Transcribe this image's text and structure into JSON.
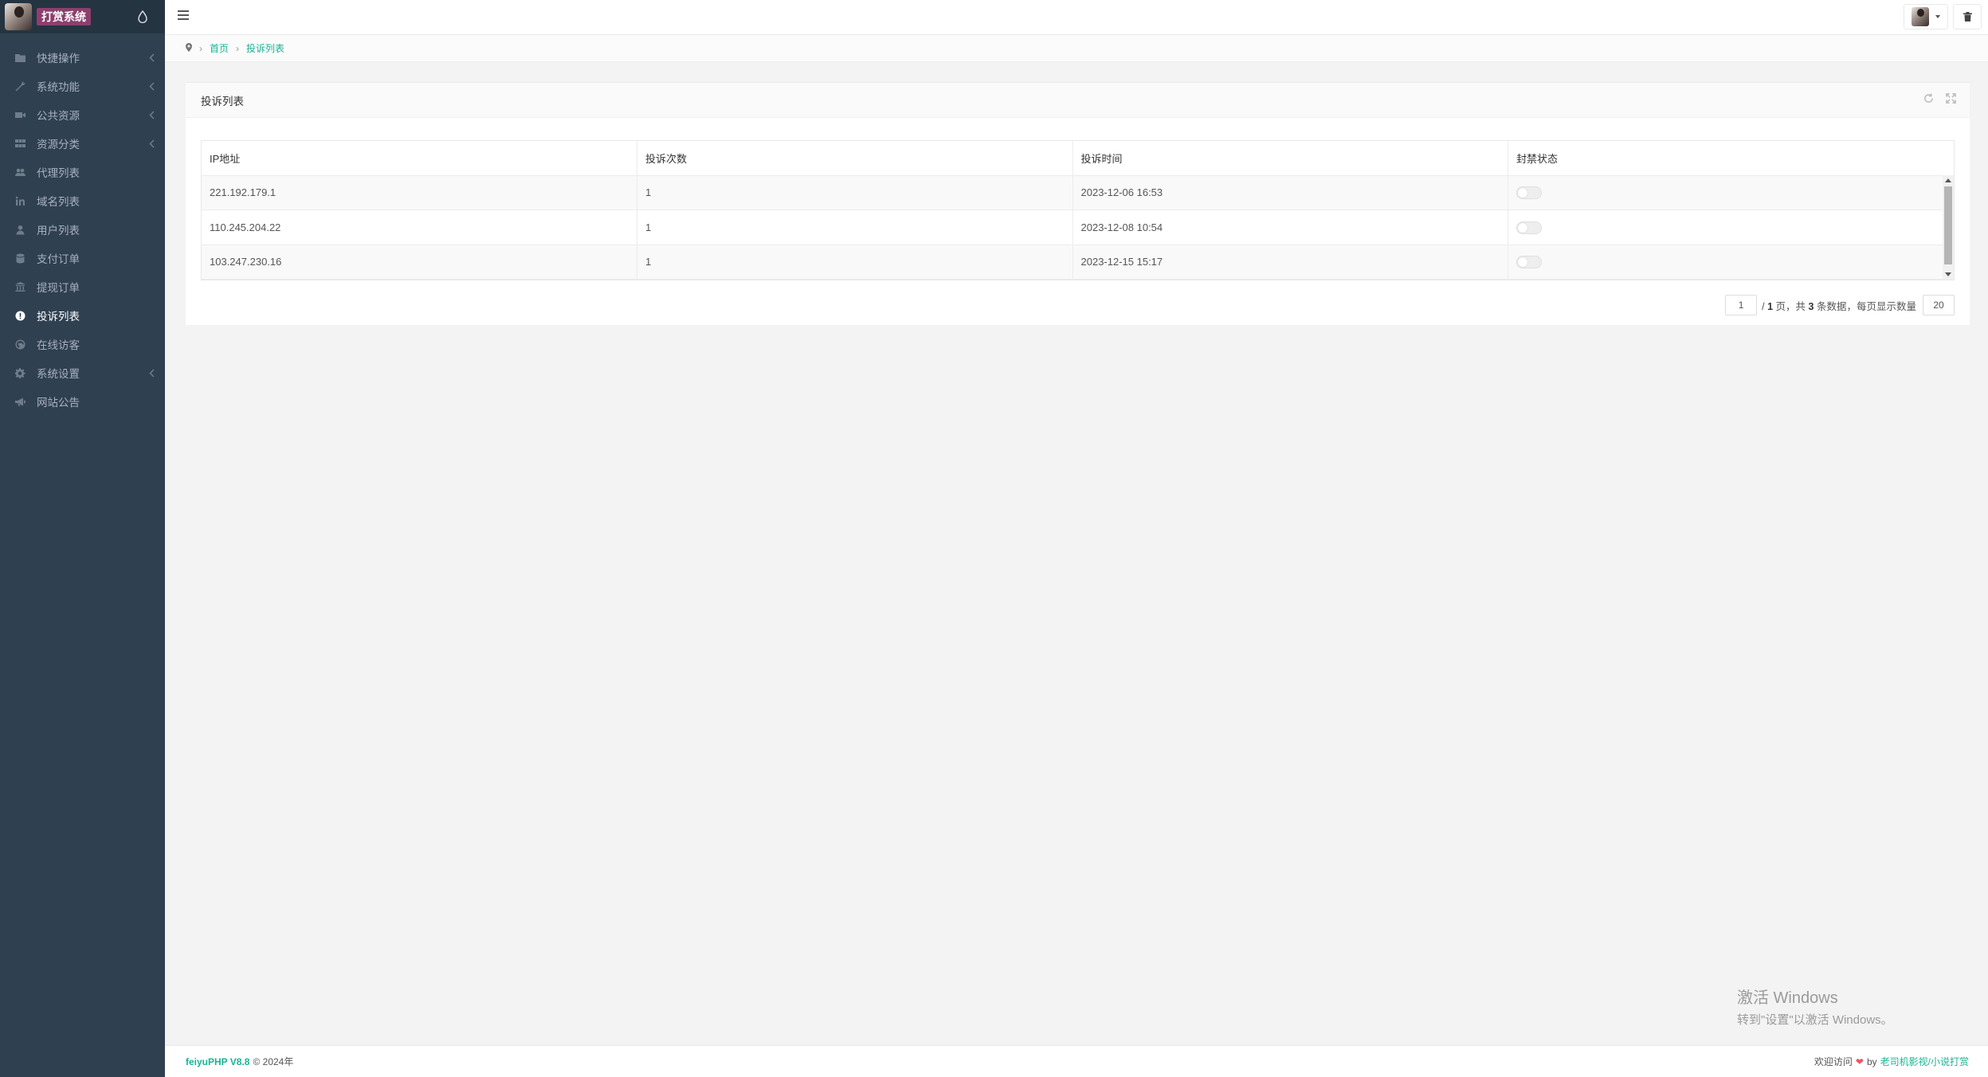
{
  "sidebar": {
    "logo_title": "打赏系统",
    "items": [
      {
        "label": "快捷操作",
        "icon": "folder-icon",
        "has_arrow": true,
        "active": false
      },
      {
        "label": "系统功能",
        "icon": "wrench-icon",
        "has_arrow": true,
        "active": false
      },
      {
        "label": "公共资源",
        "icon": "video-icon",
        "has_arrow": true,
        "active": false
      },
      {
        "label": "资源分类",
        "icon": "grid-icon",
        "has_arrow": true,
        "active": false
      },
      {
        "label": "代理列表",
        "icon": "users-icon",
        "has_arrow": false,
        "active": false
      },
      {
        "label": "域名列表",
        "icon": "linkedin-icon",
        "has_arrow": false,
        "active": false
      },
      {
        "label": "用户列表",
        "icon": "user-icon",
        "has_arrow": false,
        "active": false
      },
      {
        "label": "支付订单",
        "icon": "database-icon",
        "has_arrow": false,
        "active": false
      },
      {
        "label": "提现订单",
        "icon": "bank-icon",
        "has_arrow": false,
        "active": false
      },
      {
        "label": "投诉列表",
        "icon": "alert-icon",
        "has_arrow": false,
        "active": true
      },
      {
        "label": "在线访客",
        "icon": "globe-icon",
        "has_arrow": false,
        "active": false
      },
      {
        "label": "系统设置",
        "icon": "gear-icon",
        "has_arrow": true,
        "active": false
      },
      {
        "label": "网站公告",
        "icon": "bullhorn-icon",
        "has_arrow": false,
        "active": false
      }
    ]
  },
  "breadcrumb": {
    "home": "首页",
    "current": "投诉列表"
  },
  "panel": {
    "title": "投诉列表"
  },
  "table": {
    "columns": [
      "IP地址",
      "投诉次数",
      "投诉时间",
      "封禁状态"
    ],
    "rows": [
      {
        "ip": "221.192.179.1",
        "count": "1",
        "time": "2023-12-06 16:53",
        "banned": false
      },
      {
        "ip": "110.245.204.22",
        "count": "1",
        "time": "2023-12-08 10:54",
        "banned": false
      },
      {
        "ip": "103.247.230.16",
        "count": "1",
        "time": "2023-12-15 15:17",
        "banned": false
      }
    ]
  },
  "pager": {
    "current_page": "1",
    "slash": "/",
    "total_pages": "1",
    "page_text": "页，共",
    "total_records": "3",
    "records_text": "条数据，每页显示数量",
    "page_size": "20"
  },
  "watermark": {
    "title": "激活 Windows",
    "subtitle": "转到\"设置\"以激活 Windows。"
  },
  "footer": {
    "brand": "feiyuPHP V8.8",
    "copyright": "© 2024年",
    "welcome": "欢迎访问",
    "heart": "❤",
    "by": "by",
    "author": "老司机影视/小说打赏"
  },
  "colors": {
    "sidebar_bg": "#2f4050",
    "accent": "#1ab394",
    "logo_bg": "#8c3f6e"
  }
}
